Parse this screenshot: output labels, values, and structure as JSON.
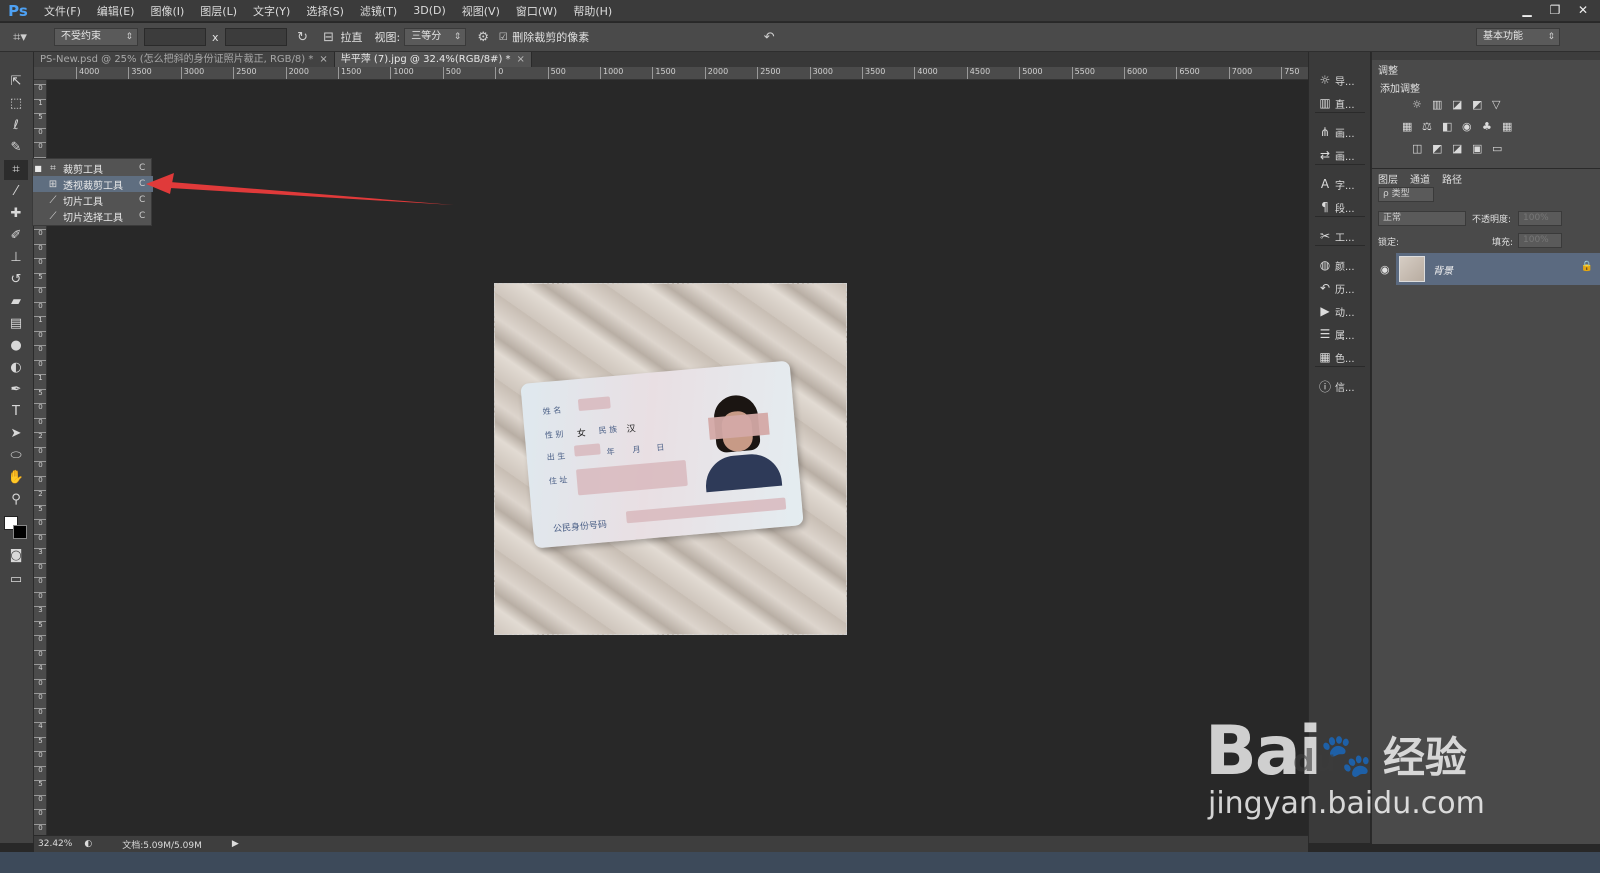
{
  "app": {
    "logo": "Ps"
  },
  "menu": [
    "文件(F)",
    "编辑(E)",
    "图像(I)",
    "图层(L)",
    "文字(Y)",
    "选择(S)",
    "滤镜(T)",
    "3D(D)",
    "视图(V)",
    "窗口(W)",
    "帮助(H)"
  ],
  "window_controls": [
    "▁",
    "❐",
    "✕"
  ],
  "options": {
    "ratio_value": "不受约束",
    "x_sep": "x",
    "straighten_label": "拉直",
    "view_label": "视图:",
    "view_value": "三等分",
    "delete_cropped_label": "删除裁剪的像素",
    "workspace_value": "基本功能"
  },
  "tabs": [
    {
      "label": "PS-New.psd @ 25% (怎么把斜的身份证照片裁正, RGB/8) *",
      "close": "×"
    },
    {
      "label": "毕平萍 (7).jpg @ 32.4%(RGB/8#) *",
      "close": "×"
    }
  ],
  "ruler_h": [
    "4000",
    "3500",
    "3000",
    "2500",
    "2000",
    "1500",
    "1000",
    "500",
    "0",
    "500",
    "1000",
    "1500",
    "2000",
    "2500",
    "3000",
    "3500",
    "4000",
    "4500",
    "5000",
    "5500",
    "6000",
    "6500",
    "7000",
    "750"
  ],
  "ruler_v": [
    "0",
    "1",
    "5",
    "0",
    "0",
    "1",
    "0",
    "0",
    "0",
    "5",
    "0",
    "0",
    "0",
    "5",
    "0",
    "0",
    "1",
    "0",
    "0",
    "0",
    "1",
    "5",
    "0",
    "0",
    "2",
    "0",
    "0",
    "0",
    "2",
    "5",
    "0",
    "0",
    "3",
    "0",
    "0",
    "0",
    "3",
    "5",
    "0",
    "0",
    "4",
    "0",
    "0",
    "0",
    "4",
    "5",
    "0",
    "0",
    "5",
    "0",
    "0",
    "0"
  ],
  "flyout": [
    {
      "mark": "■",
      "label": "裁剪工具",
      "key": "C"
    },
    {
      "mark": "",
      "label": "透视裁剪工具",
      "key": "C"
    },
    {
      "mark": "",
      "label": "切片工具",
      "key": "C"
    },
    {
      "mark": "",
      "label": "切片选择工具",
      "key": "C"
    }
  ],
  "idcard": {
    "name_label": "姓 名",
    "sex_label": "性 别",
    "sex_value": "女",
    "ethnic_label": "民 族",
    "ethnic_value": "汉",
    "birth_label": "出 生",
    "year": "年",
    "month": "月",
    "day": "日",
    "address_label": "住 址",
    "id_label": "公民身份号码"
  },
  "dock": [
    "导...",
    "直...",
    "画...",
    "画...",
    "字...",
    "段...",
    "工...",
    "颜...",
    "历...",
    "动...",
    "属...",
    "色...",
    "信..."
  ],
  "adjustments": {
    "tab": "调整",
    "title": "添加调整"
  },
  "layers": {
    "tabs": [
      "图层",
      "通道",
      "路径"
    ],
    "kind_filter": "ρ 类型",
    "blend_mode": "正常",
    "opacity_label": "不透明度:",
    "opacity_value": "100%",
    "lock_label": "锁定:",
    "fill_label": "填充:",
    "fill_value": "100%",
    "layer_name": "背景"
  },
  "status": {
    "zoom": "32.42%",
    "doc": "文档:5.09M/5.09M"
  },
  "watermark": {
    "brand": "Bai",
    "paw": "du",
    "cn": "经验",
    "url": "jingyan.baidu.com"
  },
  "colors": {
    "accent": "#4ea1f3",
    "arrow": "#e03a3a",
    "selection": "#5b6a80"
  }
}
